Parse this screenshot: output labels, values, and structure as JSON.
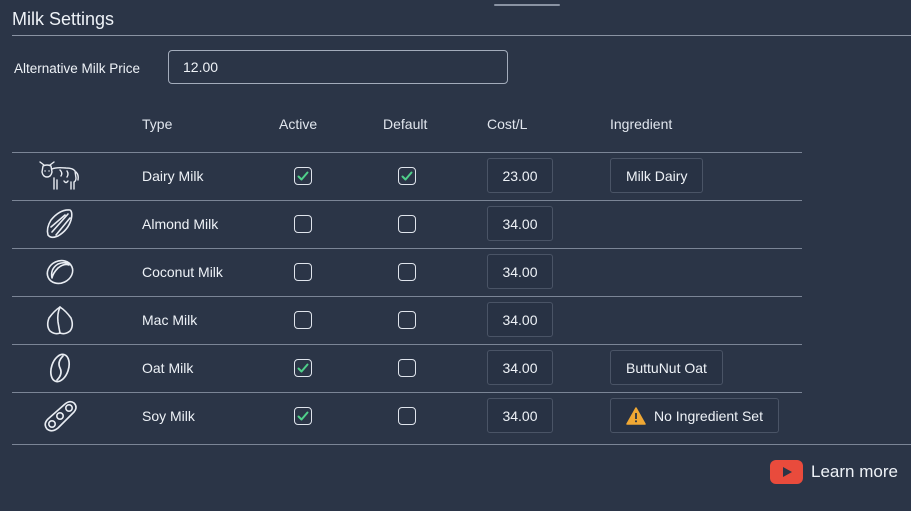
{
  "section": {
    "title": "Milk Settings"
  },
  "price": {
    "label": "Alternative Milk Price",
    "value": "12.00"
  },
  "columns": {
    "type": "Type",
    "active": "Active",
    "default": "Default",
    "cost": "Cost/L",
    "ingredient": "Ingredient"
  },
  "milks": [
    {
      "icon": "cow-icon",
      "name": "Dairy Milk",
      "active": true,
      "default": true,
      "cost": "23.00",
      "ingredient": "Milk Dairy",
      "warning": false
    },
    {
      "icon": "almond-icon",
      "name": "Almond Milk",
      "active": false,
      "default": false,
      "cost": "34.00",
      "ingredient": "",
      "warning": false
    },
    {
      "icon": "coconut-icon",
      "name": "Coconut Milk",
      "active": false,
      "default": false,
      "cost": "34.00",
      "ingredient": "",
      "warning": false
    },
    {
      "icon": "macadamia-icon",
      "name": "Mac Milk",
      "active": false,
      "default": false,
      "cost": "34.00",
      "ingredient": "",
      "warning": false
    },
    {
      "icon": "oat-icon",
      "name": "Oat Milk",
      "active": true,
      "default": false,
      "cost": "34.00",
      "ingredient": "ButtuNut Oat",
      "warning": false
    },
    {
      "icon": "soy-icon",
      "name": "Soy Milk",
      "active": true,
      "default": false,
      "cost": "34.00",
      "ingredient": "No Ingredient Set",
      "warning": true
    }
  ],
  "footer": {
    "learn_more": "Learn more"
  },
  "colors": {
    "background": "#2b3547",
    "check": "#4fd08a",
    "warning": "#f0a834",
    "youtube": "#e94b3c"
  }
}
